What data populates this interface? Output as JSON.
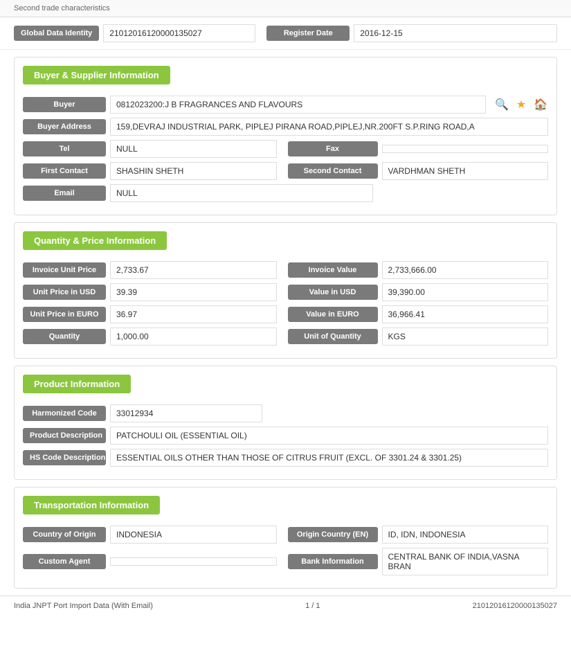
{
  "topBar": {
    "label": "Second trade characteristics"
  },
  "globalRow": {
    "label": "Global Data Identity",
    "value": "21012016120000135027",
    "registerLabel": "Register Date",
    "registerValue": "2016-12-15"
  },
  "sections": {
    "buyerSupplier": {
      "title": "Buyer & Supplier Information",
      "fields": {
        "buyerLabel": "Buyer",
        "buyerValue": "0812023200:J B FRAGRANCES AND FLAVOURS",
        "buyerAddressLabel": "Buyer Address",
        "buyerAddressValue": "159,DEVRAJ INDUSTRIAL PARK, PIPLEJ PIRANA ROAD,PIPLEJ,NR.200FT S.P.RING ROAD,A",
        "telLabel": "Tel",
        "telValue": "NULL",
        "faxLabel": "Fax",
        "faxValue": "",
        "firstContactLabel": "First Contact",
        "firstContactValue": "SHASHIN SHETH",
        "secondContactLabel": "Second Contact",
        "secondContactValue": "VARDHMAN SHETH",
        "emailLabel": "Email",
        "emailValue": "NULL"
      }
    },
    "quantityPrice": {
      "title": "Quantity & Price Information",
      "fields": {
        "invoiceUnitPriceLabel": "Invoice Unit Price",
        "invoiceUnitPriceValue": "2,733.67",
        "invoiceValueLabel": "Invoice Value",
        "invoiceValueValue": "2,733,666.00",
        "unitPriceUSDLabel": "Unit Price in USD",
        "unitPriceUSDValue": "39.39",
        "valueUSDLabel": "Value in USD",
        "valueUSDValue": "39,390.00",
        "unitPriceEUROLabel": "Unit Price in EURO",
        "unitPriceEUROValue": "36.97",
        "valueEUROLabel": "Value in EURO",
        "valueEUROValue": "36,966.41",
        "quantityLabel": "Quantity",
        "quantityValue": "1,000.00",
        "unitOfQuantityLabel": "Unit of Quantity",
        "unitOfQuantityValue": "KGS"
      }
    },
    "productInfo": {
      "title": "Product Information",
      "fields": {
        "harmonizedCodeLabel": "Harmonized Code",
        "harmonizedCodeValue": "33012934",
        "productDescLabel": "Product Description",
        "productDescValue": "PATCHOULI OIL (ESSENTIAL OIL)",
        "hsCodeDescLabel": "HS Code Description",
        "hsCodeDescValue": "ESSENTIAL OILS OTHER THAN THOSE OF CITRUS FRUIT (EXCL. OF 3301.24 & 3301.25)"
      }
    },
    "transportation": {
      "title": "Transportation Information",
      "fields": {
        "countryOfOriginLabel": "Country of Origin",
        "countryOfOriginValue": "INDONESIA",
        "originCountryENLabel": "Origin Country (EN)",
        "originCountryENValue": "ID, IDN, INDONESIA",
        "customAgentLabel": "Custom Agent",
        "customAgentValue": "",
        "bankInfoLabel": "Bank Information",
        "bankInfoValue": "CENTRAL BANK OF INDIA,VASNA BRAN"
      }
    }
  },
  "footer": {
    "left": "India JNPT Port Import Data (With Email)",
    "center": "1 / 1",
    "right": "21012016120000135027"
  }
}
